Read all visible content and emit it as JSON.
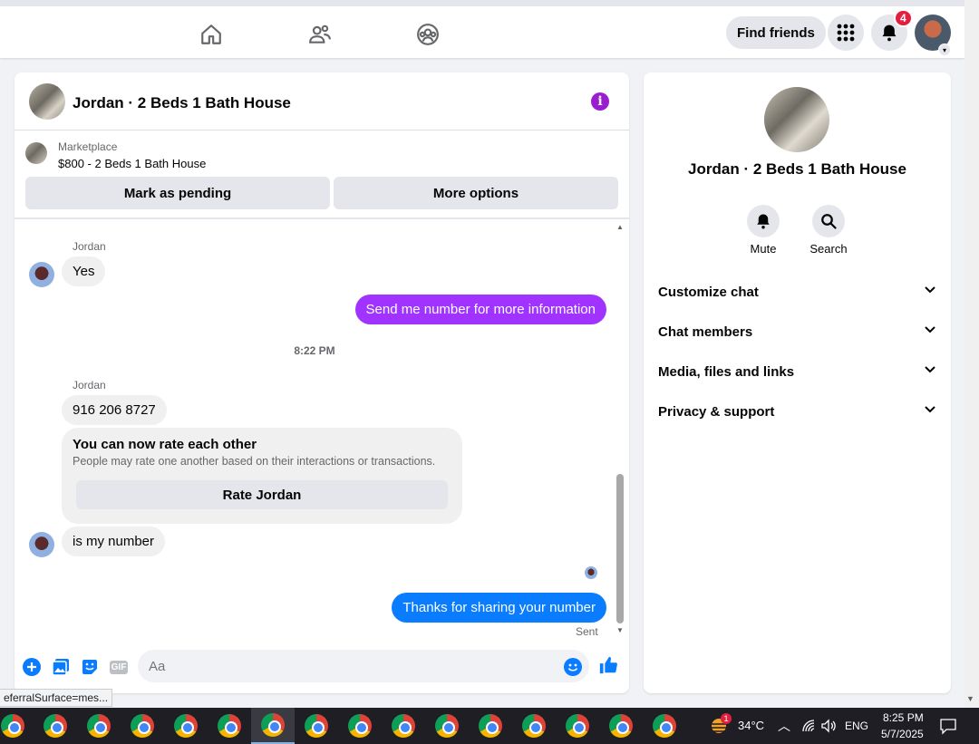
{
  "nav": {
    "find_friends": "Find friends",
    "notifications_count": "4",
    "icons": [
      "home-icon",
      "friends-icon",
      "groups-icon",
      "menu-grid-icon",
      "bell-icon"
    ]
  },
  "chat": {
    "title": "Jordan · 2 Beds 1 Bath House",
    "marketplace_label": "Marketplace",
    "listing": "$800 - 2 Beds 1 Bath House",
    "mark_pending": "Mark as pending",
    "more_options": "More options",
    "messages": [
      {
        "sender": "Jordan",
        "text": "Yes"
      },
      {
        "text": "Send me number for more information"
      },
      {
        "time": "8:22 PM"
      },
      {
        "sender": "Jordan",
        "text": "916 206 8727"
      },
      {
        "text": "is my number"
      },
      {
        "text": "Thanks for sharing your number"
      }
    ],
    "rate_card": {
      "title": "You can now rate each other",
      "subtitle": "People may rate one another based on their interactions or transactions.",
      "button": "Rate Jordan"
    },
    "sent_status": "Sent",
    "composer_placeholder": "Aa",
    "gif_label": "GIF"
  },
  "info": {
    "title": "Jordan · 2 Beds 1 Bath House",
    "mute": "Mute",
    "search": "Search",
    "rows": [
      "Customize chat",
      "Chat members",
      "Media, files and links",
      "Privacy & support"
    ]
  },
  "status_url": "eferralSurface=mes...",
  "taskbar": {
    "temperature": "34°C",
    "language": "ENG",
    "time": "8:25 PM",
    "date": "5/7/2025",
    "weather_badge": "1"
  },
  "colors": {
    "accent_purple": "#a033ff",
    "messenger_blue": "#0a7cff",
    "notif_red": "#e41e3f"
  }
}
